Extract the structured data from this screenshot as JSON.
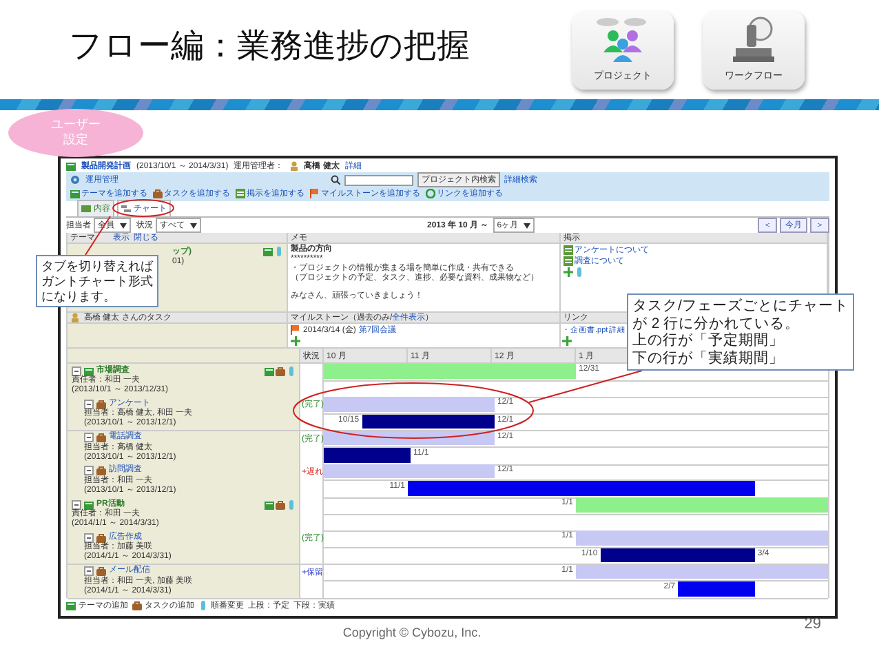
{
  "slide": {
    "title": "フロー編：業務進捗の把握",
    "badge_lines": [
      "ユーザー",
      "設定"
    ],
    "copyright": "Copyright © Cybozu, Inc.",
    "page_number": "29"
  },
  "app_tiles": [
    {
      "kind": "project",
      "label": "プロジェクト"
    },
    {
      "kind": "workflow",
      "label": "ワークフロー"
    }
  ],
  "screenshot": {
    "project_title": "製品開発計画",
    "project_period": "(2013/10/1 ～ 2014/3/31)",
    "manager_label": "運用管理者：",
    "manager": "高橋 健太",
    "detail_link": "詳細",
    "admin_link": "運用管理",
    "search_button": "プロジェクト内検索",
    "advanced_search": "詳細検索",
    "actions": [
      "テーマを追加する",
      "タスクを追加する",
      "掲示を追加する",
      "マイルストーンを追加する",
      "リンクを追加する"
    ],
    "tabs": [
      {
        "label": "内容",
        "selected": false
      },
      {
        "label": "チャート",
        "selected": true
      }
    ],
    "filters": [
      {
        "label": "担当者",
        "value": "全員"
      },
      {
        "label": "状況",
        "value": "すべて"
      }
    ],
    "period": {
      "label": "2013 年 10 月 ～",
      "value": "6ヶ月"
    },
    "nav_buttons": [
      "＜",
      "今月",
      "＞"
    ],
    "theme_header": {
      "label": "テーマ",
      "links": [
        "表示",
        "閉じる"
      ]
    },
    "project_cell": [
      "ップ)",
      "01)"
    ],
    "memo": {
      "header": "メモ",
      "lines": [
        "製品の方向",
        "**********",
        "・プロジェクトの情報が集まる場を簡単に作成・共有できる",
        "（プロジェクトの予定、タスク、進捗、必要な資料、成果物など）",
        "みなさん、頑張っていきましょう！"
      ]
    },
    "notices": {
      "header": "掲示",
      "items": [
        "アンケートについて",
        "調査について"
      ]
    },
    "tasks_header": {
      "person": "高橋 健太 さんのタスク",
      "milestone": "マイルストーン（過去のみ/",
      "milestone_link": "全件表示",
      "milestone_end": "）",
      "links": "リンク"
    },
    "milestone": {
      "date": "2014/3/14 (金)",
      "name": "第7回会議"
    },
    "link_item": {
      "name": "・企画書.ppt",
      "detail": "詳細"
    },
    "gantt": {
      "status_header": "状況",
      "months": [
        "10 月",
        "11 月",
        "12 月",
        "1 月"
      ],
      "rows": [
        {
          "kind": "theme",
          "name": "市場調査",
          "person": "責任者：和田 一夫",
          "period": "(2013/10/1 ～ 2013/12/31)",
          "bars": [
            {
              "kind": "plan",
              "color": "#8ef08a",
              "end": "12/31"
            }
          ]
        },
        {
          "kind": "task",
          "name": "アンケート",
          "person": "担当者：高橋 健太, 和田 一夫",
          "period": "(2013/10/1 ～ 2013/12/1)",
          "status": {
            "kind": "done",
            "text": "(完了)"
          },
          "bars": [
            {
              "kind": "plan",
              "color": "#c8c8f4",
              "end": "12/1"
            },
            {
              "kind": "actual",
              "color": "#00008c",
              "start": "10/15",
              "end": "12/1"
            }
          ]
        },
        {
          "kind": "task",
          "name": "電話調査",
          "person": "担当者：高橋 健太",
          "period": "(2013/10/1 ～ 2013/12/1)",
          "status": {
            "kind": "done",
            "text": "(完了)"
          },
          "bars": [
            {
              "kind": "plan",
              "color": "#c8c8f4",
              "end": "12/1"
            },
            {
              "kind": "actual",
              "color": "#00008c",
              "end": "11/1"
            }
          ]
        },
        {
          "kind": "task",
          "name": "訪問調査",
          "person": "担当者：和田 一夫",
          "period": "(2013/10/1 ～ 2013/12/1)",
          "status": {
            "kind": "late",
            "text": "+遅れ"
          },
          "bars": [
            {
              "kind": "plan",
              "color": "#c8c8f4",
              "end": "12/1"
            },
            {
              "kind": "actual",
              "color": "#0000ee",
              "start": "11/1",
              "in_progress": true
            }
          ]
        },
        {
          "kind": "theme",
          "name": "PR活動",
          "person": "責任者：和田 一夫",
          "period": "(2014/1/1 ～ 2014/3/31)",
          "bars": [
            {
              "kind": "plan",
              "color": "#8ef08a",
              "start": "1/1"
            }
          ]
        },
        {
          "kind": "task",
          "name": "広告作成",
          "person": "担当者：加藤 美咲",
          "period": "(2014/1/1 ～ 2014/3/31)",
          "status": {
            "kind": "done",
            "text": "(完了)"
          },
          "bars": [
            {
              "kind": "plan",
              "color": "#c8c8f4",
              "start": "1/1"
            },
            {
              "kind": "actual",
              "color": "#00008c",
              "start": "1/10",
              "end": "3/4"
            }
          ]
        },
        {
          "kind": "task",
          "name": "メール配信",
          "person": "担当者：和田 一夫, 加藤 美咲",
          "period": "(2014/1/1 ～ 2014/3/31)",
          "status": {
            "kind": "hold",
            "text": "+保留"
          },
          "bars": [
            {
              "kind": "plan",
              "color": "#c8c8f4",
              "start": "1/1"
            },
            {
              "kind": "actual",
              "color": "#0000ee",
              "start": "2/7",
              "in_progress": true
            }
          ]
        }
      ]
    },
    "legend": [
      {
        "kind": "theme",
        "text": "テーマの追加"
      },
      {
        "kind": "task",
        "text": "タスクの追加"
      },
      {
        "kind": "sort",
        "text": "順番変更"
      },
      {
        "kind": "none",
        "text": "上段：予定"
      },
      {
        "kind": "none",
        "text": "下段：実績"
      }
    ]
  },
  "callouts": [
    {
      "lines": [
        "タブを切り替えれば",
        "ガントチャート形式",
        "になります。"
      ]
    },
    {
      "lines": [
        "タスク/フェーズごとにチャート",
        "が 2 行に分かれている。",
        "上の行が「予定期間」",
        "下の行が「実績期間」"
      ]
    }
  ]
}
